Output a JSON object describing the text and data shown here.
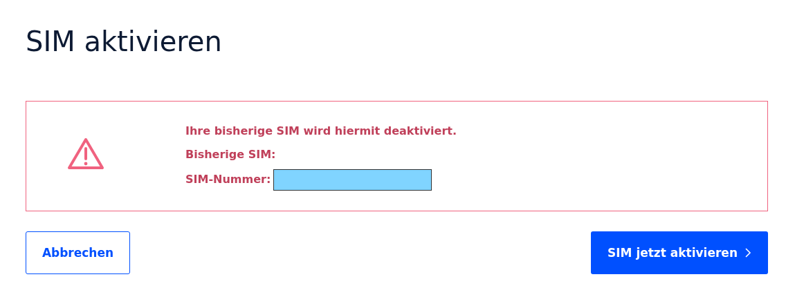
{
  "page": {
    "title": "SIM aktivieren"
  },
  "warning": {
    "message": "Ihre bisherige SIM wird hiermit deaktiviert.",
    "lines": [
      {
        "kind": "text",
        "label": "Bisherige SIM:"
      },
      {
        "kind": "redacted",
        "label": "SIM-Nummer:"
      }
    ]
  },
  "buttons": [
    {
      "kind": "secondary",
      "label": "Abbrechen"
    },
    {
      "kind": "primary",
      "label": "SIM jetzt aktivieren"
    }
  ]
}
